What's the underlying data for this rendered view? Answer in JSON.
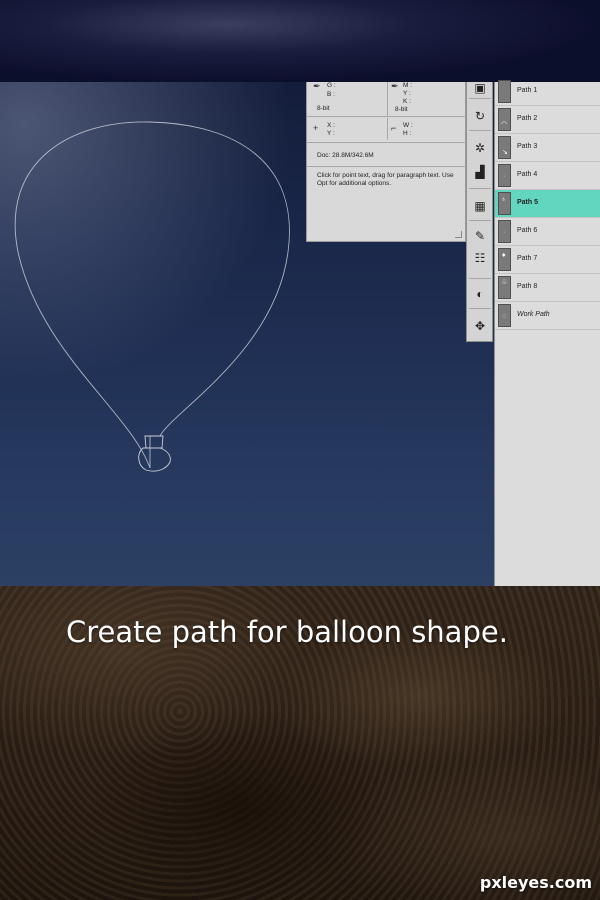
{
  "info_panel": {
    "g_label": "G :",
    "b_label": "B :",
    "bit_left": "8-bit",
    "m_label": "M :",
    "y_label": "Y :",
    "k_label": "K :",
    "bit_right": "8-bit",
    "x_label": "X :",
    "y2_label": "Y :",
    "w_label": "W :",
    "h_label": "H :",
    "doc": "Doc: 28.8M/342.6M",
    "hint": "Click for point text, drag for paragraph text. Use Opt for additional options."
  },
  "tools": [
    {
      "icon": "info-icon",
      "glyph": "▣"
    },
    {
      "icon": "history-icon",
      "glyph": "↻"
    },
    {
      "icon": "navigator-icon",
      "glyph": "✲"
    },
    {
      "icon": "histogram-icon",
      "glyph": "▟"
    },
    {
      "icon": "swatches-icon",
      "glyph": "▦"
    },
    {
      "icon": "brushes-icon",
      "glyph": "✎"
    },
    {
      "icon": "tool-presets-icon",
      "glyph": "☷"
    },
    {
      "icon": "clone-source-icon",
      "glyph": "⊥"
    },
    {
      "icon": "adjustments-icon",
      "glyph": "◐"
    },
    {
      "icon": "styles-icon",
      "glyph": "✥"
    }
  ],
  "paths": [
    {
      "name": "Path 1",
      "mark": ""
    },
    {
      "name": "Path 2",
      "mark": "◠"
    },
    {
      "name": "Path 3",
      "mark": "↘"
    },
    {
      "name": "Path 4",
      "mark": "·"
    },
    {
      "name": "Path 5",
      "mark": "♁"
    },
    {
      "name": "Path 6",
      "mark": "·"
    },
    {
      "name": "Path 7",
      "mark": "♦"
    },
    {
      "name": "Path 8",
      "mark": "♧"
    },
    {
      "name": "Work Path",
      "mark": "◌"
    }
  ],
  "selected_path": "Path 5",
  "caption": "Create path for balloon shape.",
  "watermark": "pxleyes.com"
}
